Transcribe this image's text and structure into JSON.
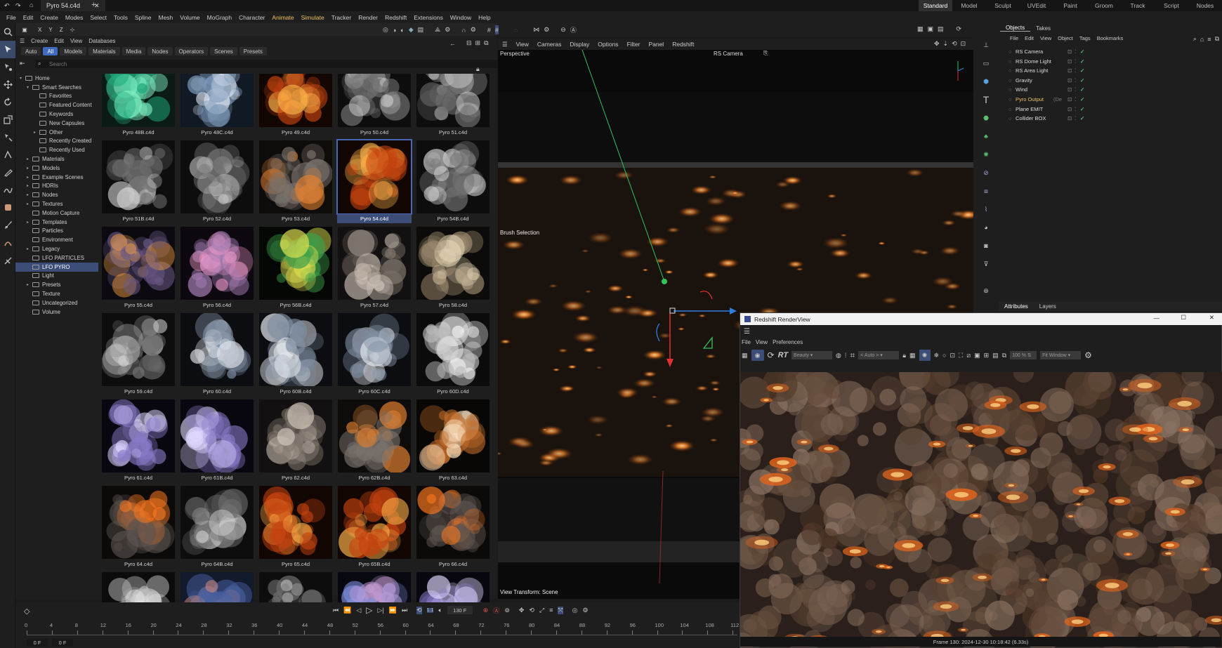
{
  "titlebar": {
    "doc_tab": "Pyro 54.c4d",
    "layouts": [
      "Standard",
      "Model",
      "Sculpt",
      "UVEdit",
      "Paint",
      "Groom",
      "Track",
      "Script",
      "Nodes"
    ],
    "active_layout": "Standard"
  },
  "menu": [
    "File",
    "Edit",
    "Create",
    "Modes",
    "Select",
    "Tools",
    "Spline",
    "Mesh",
    "Volume",
    "MoGraph",
    "Character",
    "Animate",
    "Simulate",
    "Tracker",
    "Render",
    "Redshift",
    "Extensions",
    "Window",
    "Help"
  ],
  "asset_browser": {
    "top_menu": [
      "Create",
      "Edit",
      "View",
      "Databases"
    ],
    "filters": [
      "Auto",
      "All",
      "Models",
      "Materials",
      "Media",
      "Nodes",
      "Operators",
      "Scenes",
      "Presets"
    ],
    "active_filter": "All",
    "search_placeholder": "Search",
    "tree": [
      {
        "label": "Home",
        "indent": 0,
        "arrow": "▾"
      },
      {
        "label": "Smart Searches",
        "indent": 1,
        "arrow": "▾"
      },
      {
        "label": "Favorites",
        "indent": 2,
        "arrow": ""
      },
      {
        "label": "Featured Content",
        "indent": 2,
        "arrow": ""
      },
      {
        "label": "Keywords",
        "indent": 2,
        "arrow": ""
      },
      {
        "label": "New Capsules",
        "indent": 2,
        "arrow": ""
      },
      {
        "label": "Other",
        "indent": 2,
        "arrow": "▸"
      },
      {
        "label": "Recently Created",
        "indent": 2,
        "arrow": ""
      },
      {
        "label": "Recently Used",
        "indent": 2,
        "arrow": ""
      },
      {
        "label": "Materials",
        "indent": 1,
        "arrow": "▸"
      },
      {
        "label": "Models",
        "indent": 1,
        "arrow": "▸"
      },
      {
        "label": "Example Scenes",
        "indent": 1,
        "arrow": "▸"
      },
      {
        "label": "HDRIs",
        "indent": 1,
        "arrow": "▸"
      },
      {
        "label": "Nodes",
        "indent": 1,
        "arrow": "▸"
      },
      {
        "label": "Textures",
        "indent": 1,
        "arrow": "▸"
      },
      {
        "label": "Motion Capture",
        "indent": 1,
        "arrow": ""
      },
      {
        "label": "Templates",
        "indent": 1,
        "arrow": "▸"
      },
      {
        "label": "Particles",
        "indent": 1,
        "arrow": ""
      },
      {
        "label": "Environment",
        "indent": 1,
        "arrow": ""
      },
      {
        "label": "Legacy",
        "indent": 1,
        "arrow": "▸"
      },
      {
        "label": "LFO PARTICLES",
        "indent": 1,
        "arrow": ""
      },
      {
        "label": "LFO PYRO",
        "indent": 1,
        "arrow": "",
        "selected": true
      },
      {
        "label": "Light",
        "indent": 1,
        "arrow": ""
      },
      {
        "label": "Presets",
        "indent": 1,
        "arrow": "▸"
      },
      {
        "label": "Texture",
        "indent": 1,
        "arrow": ""
      },
      {
        "label": "Uncategorized",
        "indent": 1,
        "arrow": ""
      },
      {
        "label": "Volume",
        "indent": 1,
        "arrow": ""
      }
    ],
    "assets": [
      {
        "name": "Pyro 48B.c4d",
        "style": "teal"
      },
      {
        "name": "Pyro 48C.c4d",
        "style": "whiteblue"
      },
      {
        "name": "Pyro 49.c4d",
        "style": "fire"
      },
      {
        "name": "Pyro 50.c4d",
        "style": "grey"
      },
      {
        "name": "Pyro 51.c4d",
        "style": "grey"
      },
      {
        "name": "Pyro 51B.c4d",
        "style": "grey"
      },
      {
        "name": "Pyro 52.c4d",
        "style": "grey"
      },
      {
        "name": "Pyro 53.c4d",
        "style": "greyfire"
      },
      {
        "name": "Pyro 54.c4d",
        "style": "fire",
        "selected": true
      },
      {
        "name": "Pyro 54B.c4d",
        "style": "grey"
      },
      {
        "name": "Pyro 55.c4d",
        "style": "firecloud"
      },
      {
        "name": "Pyro 56.c4d",
        "style": "pink"
      },
      {
        "name": "Pyro 56B.c4d",
        "style": "green"
      },
      {
        "name": "Pyro 57.c4d",
        "style": "greybrown"
      },
      {
        "name": "Pyro 58.c4d",
        "style": "beige"
      },
      {
        "name": "Pyro 59.c4d",
        "style": "grey"
      },
      {
        "name": "Pyro 60.c4d",
        "style": "bluegrey"
      },
      {
        "name": "Pyro 60B.c4d",
        "style": "bluegrey"
      },
      {
        "name": "Pyro 60C.c4d",
        "style": "bluegrey"
      },
      {
        "name": "Pyro 60D.c4d",
        "style": "white"
      },
      {
        "name": "Pyro 61.c4d",
        "style": "violet"
      },
      {
        "name": "Pyro 61B.c4d",
        "style": "violet"
      },
      {
        "name": "Pyro 62.c4d",
        "style": "greybrown"
      },
      {
        "name": "Pyro 62B.c4d",
        "style": "greyfire"
      },
      {
        "name": "Pyro 63.c4d",
        "style": "orb"
      },
      {
        "name": "Pyro 64.c4d",
        "style": "smokefire"
      },
      {
        "name": "Pyro 64B.c4d",
        "style": "grey"
      },
      {
        "name": "Pyro 65.c4d",
        "style": "fire"
      },
      {
        "name": "Pyro 65B.c4d",
        "style": "fire"
      },
      {
        "name": "Pyro 66.c4d",
        "style": "smokefire"
      },
      {
        "name": "",
        "style": "white"
      },
      {
        "name": "",
        "style": "bluepink"
      },
      {
        "name": "",
        "style": "grey"
      },
      {
        "name": "",
        "style": "pinkblue"
      },
      {
        "name": "",
        "style": "violet"
      }
    ]
  },
  "viewport": {
    "menu": [
      "View",
      "Cameras",
      "Display",
      "Options",
      "Filter",
      "Panel",
      "Redshift"
    ],
    "label": "Perspective",
    "camera": "RS Camera",
    "brush": "Brush Selection",
    "transform": "View Transform: Scene"
  },
  "objects": {
    "tabs": [
      "Objects",
      "Takes"
    ],
    "menu": [
      "File",
      "Edit",
      "View",
      "Object",
      "Tags",
      "Bookmarks"
    ],
    "items": [
      {
        "name": "RS Camera",
        "color": "#dddddd"
      },
      {
        "name": "RS Dome Light",
        "color": "#dddddd"
      },
      {
        "name": "RS Area Light",
        "color": "#dddddd"
      },
      {
        "name": "Gravity",
        "color": "#dddddd"
      },
      {
        "name": "Wind",
        "color": "#dddddd"
      },
      {
        "name": "Pyro Output",
        "color": "#e8c060",
        "suffix": "(De"
      },
      {
        "name": "Plane EMIT",
        "color": "#dddddd"
      },
      {
        "name": "Collider BOX",
        "color": "#dddddd"
      }
    ]
  },
  "attributes": {
    "tabs": [
      "Attributes",
      "Layers"
    ]
  },
  "renderview": {
    "title": "Redshift RenderView",
    "menu": [
      "File",
      "View",
      "Preferences"
    ],
    "aov": "Beauty",
    "auto": "< Auto >",
    "zoom": "100 %",
    "fit": "Fit Window",
    "status": "Frame  130:  2024-12-30  10:18:42  (6.33s)"
  },
  "timeline": {
    "frame": "130 F",
    "start": "0 F",
    "end": "0 F",
    "ticks": [
      "0",
      "4",
      "8",
      "12",
      "16",
      "20",
      "24",
      "28",
      "32",
      "36",
      "40",
      "44",
      "48",
      "52",
      "56",
      "60",
      "64",
      "68",
      "72",
      "76",
      "80",
      "84",
      "88",
      "92",
      "96",
      "100",
      "104",
      "108",
      "112"
    ]
  }
}
